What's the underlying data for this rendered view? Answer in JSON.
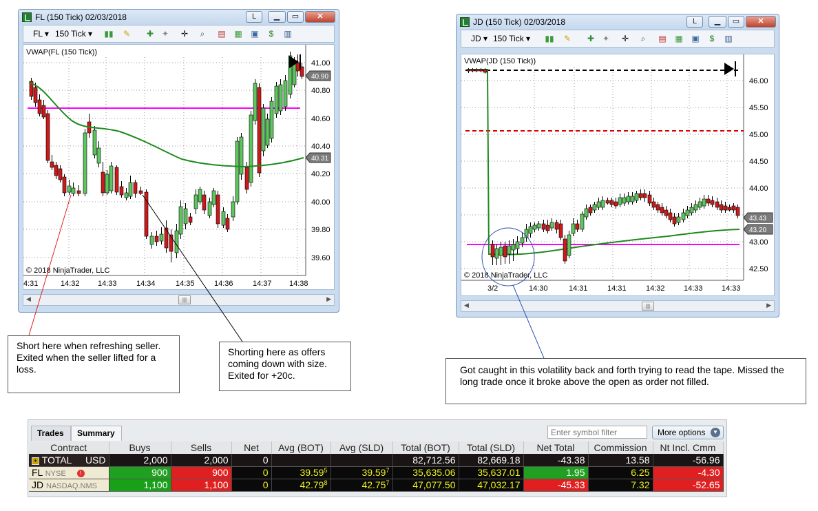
{
  "fl_window": {
    "title": "FL (150 Tick)  02/03/2018",
    "link_btn": "L",
    "toolbar": {
      "instrument": "FL",
      "interval": "150 Tick"
    },
    "indicator_label": "VWAP(FL (150 Tick))",
    "copyright": "© 2018 NinjaTrader, LLC",
    "price_labels": [
      "41.00",
      "40.80",
      "40.60",
      "40.40",
      "40.20",
      "40.00",
      "39.80",
      "39.60"
    ],
    "badges": {
      "last": "40.90",
      "vwap": "40.31"
    },
    "time_labels": [
      "4:31",
      "14:32",
      "14:33",
      "14:34",
      "14:35",
      "14:36",
      "14:37",
      "14:38"
    ],
    "colors": {
      "up": "#5ec65e",
      "down": "#cc1a1a",
      "vwap": "#1e8a1e",
      "level": "#ff00ff"
    }
  },
  "jd_window": {
    "title": "JD (150 Tick)  02/03/2018",
    "link_btn": "L",
    "toolbar": {
      "instrument": "JD",
      "interval": "150 Tick"
    },
    "indicator_label": "VWAP(JD (150 Tick))",
    "copyright": "© 2018 NinjaTrader, LLC",
    "price_labels": [
      "46.00",
      "45.50",
      "45.00",
      "44.50",
      "44.00",
      "43.50",
      "43.00",
      "42.50"
    ],
    "badges": {
      "last": "43.43",
      "vwap": "43.20"
    },
    "time_labels": [
      "3/2",
      "14:30",
      "14:31",
      "14:31",
      "14:32",
      "14:33",
      "14:33"
    ],
    "colors": {
      "open_line": "#000000",
      "red_line": "#dd0000",
      "level": "#ff00ff"
    }
  },
  "notes": {
    "fl_short_refresh": "Short here when refreshing seller. Exited when the seller lifted for a loss.",
    "fl_short_offers": "Shorting here as offers coming down with size. Exited for +20c.",
    "jd_volatility": "Got caught in this volatility back and forth trying to read the tape. Missed the long trade once it broke above the open as order not filled."
  },
  "account_grid": {
    "tabs": [
      "Trades",
      "Summary"
    ],
    "active_tab": "Summary",
    "filter_placeholder": "Enter symbol filter",
    "more_options": "More options",
    "columns": [
      "Contract",
      "Buys",
      "Sells",
      "Net",
      "Avg (BOT)",
      "Avg (SLD)",
      "Total (BOT)",
      "Total (SLD)",
      "Net Total",
      "Commission",
      "Nt Incl. Cmm"
    ],
    "rows": [
      {
        "contract": "TOTAL",
        "exchange": "USD",
        "buys": "2,000",
        "sells": "2,000",
        "net": "0",
        "avg_bot": "",
        "avg_bot_sup": "",
        "avg_sld": "",
        "avg_sld_sup": "",
        "total_bot": "82,712.56",
        "total_sld": "82,669.18",
        "net_total": "-43.38",
        "commission": "13.58",
        "incl_cmm": "-56.96"
      },
      {
        "contract": "FL",
        "exchange": "NYSE",
        "buys": "900",
        "sells": "900",
        "net": "0",
        "avg_bot": "39.59",
        "avg_bot_sup": "5",
        "avg_sld": "39.59",
        "avg_sld_sup": "7",
        "total_bot": "35,635.06",
        "total_sld": "35,637.01",
        "net_total": "1.95",
        "commission": "6.25",
        "incl_cmm": "-4.30"
      },
      {
        "contract": "JD",
        "exchange": "NASDAQ.NMS",
        "buys": "1,100",
        "sells": "1,100",
        "net": "0",
        "avg_bot": "42.79",
        "avg_bot_sup": "8",
        "avg_sld": "42.75",
        "avg_sld_sup": "7",
        "total_bot": "47,077.50",
        "total_sld": "47,032.17",
        "net_total": "-45.33",
        "commission": "7.32",
        "incl_cmm": "-52.65"
      }
    ]
  }
}
